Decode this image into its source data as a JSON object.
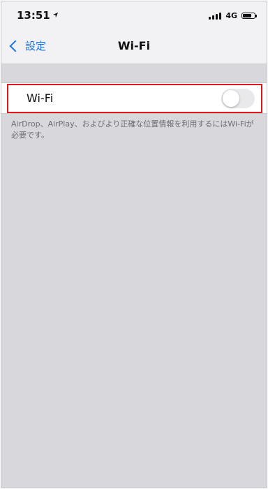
{
  "status_bar": {
    "time": "13:51",
    "location_icon": "location-arrow-icon",
    "network": "4G",
    "signal_bars": 4,
    "battery_level": 0.75
  },
  "nav": {
    "back_label": "設定",
    "title": "Wi-Fi"
  },
  "wifi_setting": {
    "label": "Wi-Fi",
    "enabled": false
  },
  "footer_note": "AirDrop、AirPlay、およびより正確な位置情報を利用するにはWi-Fiが必要です。",
  "colors": {
    "accent": "#1a73e8",
    "highlight": "#e0181b",
    "background": "#d8d8dc",
    "toggle_off": "#e9e9eb"
  }
}
